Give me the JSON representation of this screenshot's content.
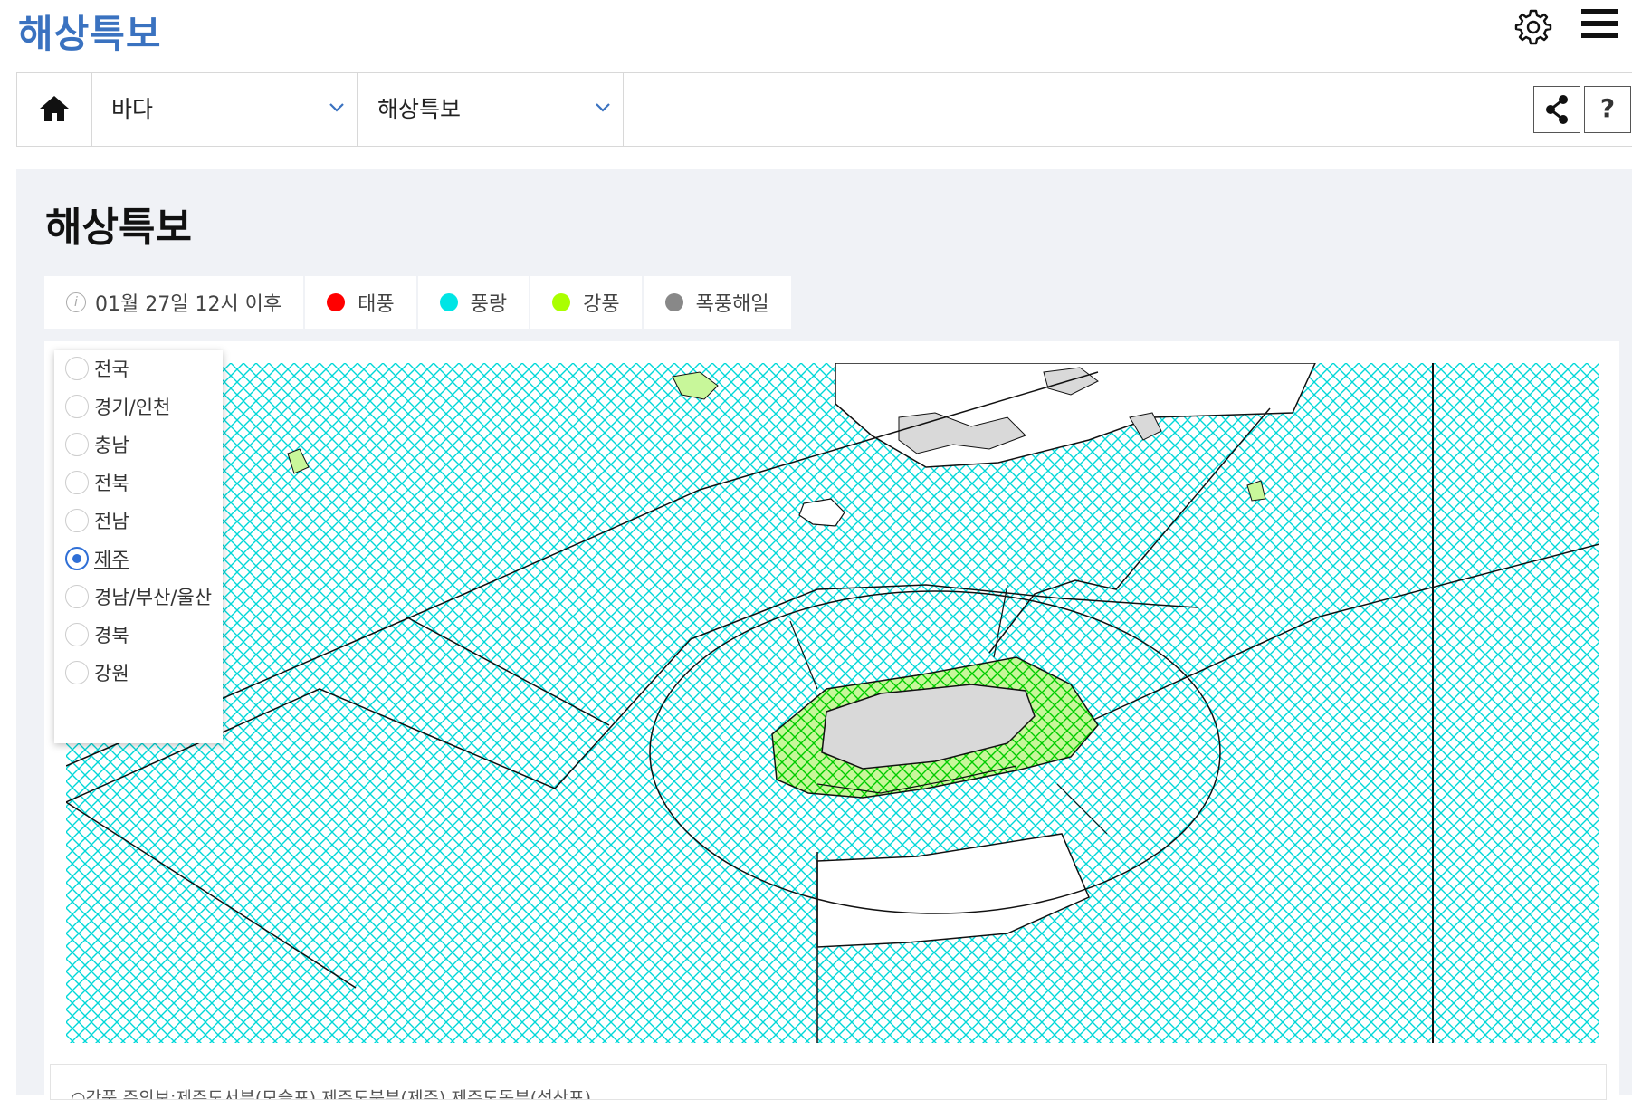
{
  "app": {
    "title": "해상특보"
  },
  "header": {
    "settings_icon": "gear-icon",
    "menu_icon": "hamburger-menu-icon"
  },
  "nav": {
    "home_icon": "home-icon",
    "category": "바다",
    "subcategory": "해상특보",
    "share_icon": "share-icon",
    "help_label": "?"
  },
  "page": {
    "title": "해상특보"
  },
  "legend": {
    "time": "01월 27일 12시 이후",
    "items": [
      {
        "label": "태풍",
        "color": "#ff0000"
      },
      {
        "label": "풍랑",
        "color": "#00e5e5"
      },
      {
        "label": "강풍",
        "color": "#aaff00"
      },
      {
        "label": "폭풍해일",
        "color": "#888888"
      }
    ]
  },
  "regions": {
    "options": [
      "전국",
      "경기/인천",
      "충남",
      "전북",
      "전남",
      "제주",
      "경남/부산/울산",
      "경북",
      "강원"
    ],
    "selected": "제주"
  },
  "footnote": {
    "text": "○강풍 주의보:제주도서부(모슬포),제주도북부(제주),제주도동부(성산포)"
  },
  "colors": {
    "accent": "#3a72c0",
    "map_hatch": "#00d5d5",
    "gale_zone": "#aaff00",
    "land": "#d9d9d9"
  }
}
